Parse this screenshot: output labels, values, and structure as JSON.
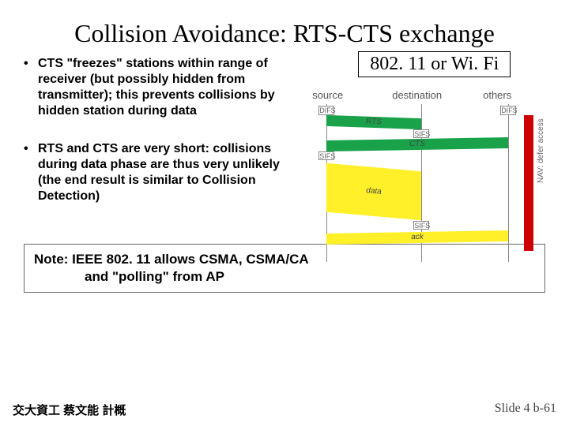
{
  "title_a": "Collision Avoidance:",
  "title_b": "RTS-CTS exchange",
  "badge": "802. 11 or Wi. Fi",
  "bullets": [
    "CTS \"freezes\" stations within range of receiver (but possibly hidden from transmitter); this prevents collisions by hidden station during data",
    "RTS and CTS are very short: collisions during data phase are thus very unlikely (the end result is similar to Collision Detection)"
  ],
  "diagram": {
    "col1": "source",
    "col2": "destination",
    "col3": "others",
    "difs": "DIFS",
    "sifs": "SIFS",
    "rts": "RTS",
    "cts": "CTS",
    "data": "data",
    "ack": "ack",
    "nav": "NAV: defer access"
  },
  "note_line1": "Note: IEEE 802. 11 allows CSMA, CSMA/CA",
  "note_line2": "and \"polling\" from AP",
  "footer_left": "交大資工 蔡文能 計概",
  "footer_right": "Slide 4 b-61"
}
